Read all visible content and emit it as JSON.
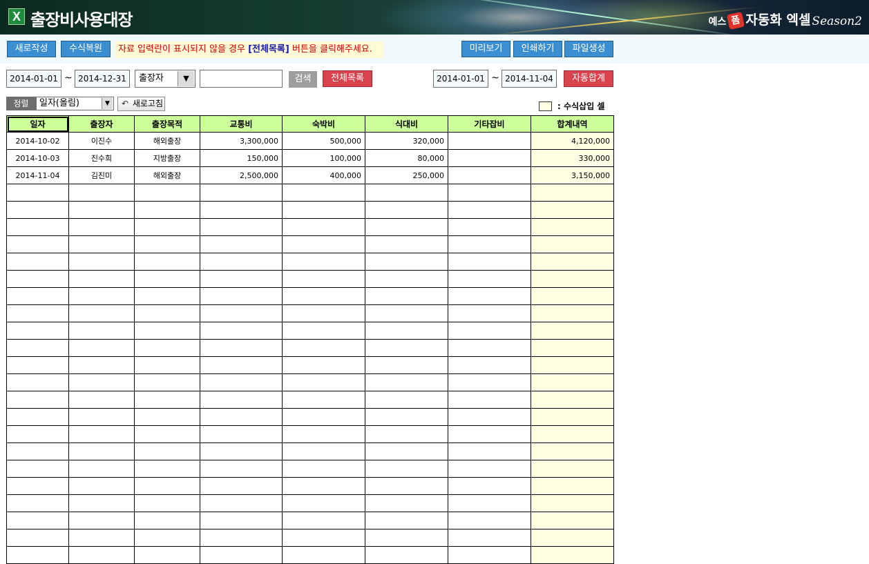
{
  "app": {
    "title": "출장비사용대장",
    "brand_prefix": "예스",
    "brand_plus": "폼",
    "brand_name": "자동화 엑셀",
    "brand_season": "Season2"
  },
  "toolbar": {
    "new_label": "새로작성",
    "restore_formula_label": "수식복원",
    "notice_prefix": "자료 입력란이 표시되지  않을 경우 ",
    "notice_highlight": "[전체목록]",
    "notice_suffix": " 버튼을 클릭해주세요.",
    "preview_label": "미리보기",
    "print_label": "인쇄하기",
    "file_create_label": "파일생성"
  },
  "filter": {
    "start_date": "2014-01-01",
    "tilde": "~",
    "end_date": "2014-12-31",
    "field_select": "출장자",
    "search_value": "",
    "search_label": "검색",
    "all_list_label": "전체목록",
    "sum_start_date": "2014-01-01",
    "sum_end_date": "2014-11-04",
    "auto_sum_label": "자동합계"
  },
  "sort": {
    "label": "정렬",
    "value": "일자(올림)",
    "refresh_label": "새로고침",
    "legend_text": ": 수식삽입 셀"
  },
  "table": {
    "columns": [
      "일자",
      "출장자",
      "출장목적",
      "교통비",
      "숙박비",
      "식대비",
      "기타잡비",
      "합계내역"
    ],
    "rows": [
      [
        "2014-10-02",
        "이진수",
        "해외출장",
        "3,300,000",
        "500,000",
        "320,000",
        "",
        "4,120,000"
      ],
      [
        "2014-10-03",
        "진수희",
        "지방출장",
        "150,000",
        "100,000",
        "80,000",
        "",
        "330,000"
      ],
      [
        "2014-11-04",
        "김진미",
        "해외출장",
        "2,500,000",
        "400,000",
        "250,000",
        "",
        "3,150,000"
      ],
      [
        "",
        "",
        "",
        "",
        "",
        "",
        "",
        ""
      ],
      [
        "",
        "",
        "",
        "",
        "",
        "",
        "",
        ""
      ],
      [
        "",
        "",
        "",
        "",
        "",
        "",
        "",
        ""
      ],
      [
        "",
        "",
        "",
        "",
        "",
        "",
        "",
        ""
      ],
      [
        "",
        "",
        "",
        "",
        "",
        "",
        "",
        ""
      ],
      [
        "",
        "",
        "",
        "",
        "",
        "",
        "",
        ""
      ],
      [
        "",
        "",
        "",
        "",
        "",
        "",
        "",
        ""
      ],
      [
        "",
        "",
        "",
        "",
        "",
        "",
        "",
        ""
      ],
      [
        "",
        "",
        "",
        "",
        "",
        "",
        "",
        ""
      ],
      [
        "",
        "",
        "",
        "",
        "",
        "",
        "",
        ""
      ],
      [
        "",
        "",
        "",
        "",
        "",
        "",
        "",
        ""
      ],
      [
        "",
        "",
        "",
        "",
        "",
        "",
        "",
        ""
      ],
      [
        "",
        "",
        "",
        "",
        "",
        "",
        "",
        ""
      ],
      [
        "",
        "",
        "",
        "",
        "",
        "",
        "",
        ""
      ],
      [
        "",
        "",
        "",
        "",
        "",
        "",
        "",
        ""
      ],
      [
        "",
        "",
        "",
        "",
        "",
        "",
        "",
        ""
      ],
      [
        "",
        "",
        "",
        "",
        "",
        "",
        "",
        ""
      ],
      [
        "",
        "",
        "",
        "",
        "",
        "",
        "",
        ""
      ],
      [
        "",
        "",
        "",
        "",
        "",
        "",
        "",
        ""
      ],
      [
        "",
        "",
        "",
        "",
        "",
        "",
        "",
        ""
      ],
      [
        "",
        "",
        "",
        "",
        "",
        "",
        "",
        ""
      ],
      [
        "",
        "",
        "",
        "",
        "",
        "",
        "",
        ""
      ]
    ]
  },
  "colors": {
    "header_green": "#ccff99",
    "formula_cell": "#fffde2",
    "button_blue": "#3b8ed0",
    "button_red": "#d9434e"
  },
  "icons": {
    "excel": "excel-icon",
    "dropdown": "chevron-down-icon",
    "refresh": "refresh-icon"
  }
}
